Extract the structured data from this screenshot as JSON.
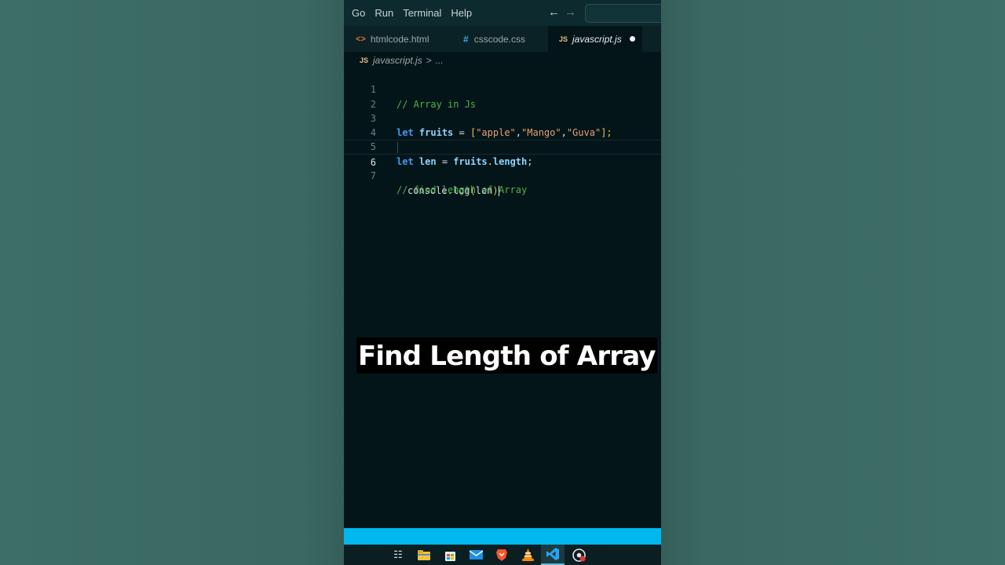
{
  "menubar": {
    "items": [
      "Go",
      "Run",
      "Terminal",
      "Help"
    ],
    "back_icon": "arrow-left-icon",
    "forward_icon": "arrow-right-icon"
  },
  "tabs": [
    {
      "label": "htmlcode.html",
      "icon": "html-file-icon",
      "icon_glyph": "<>",
      "active": false
    },
    {
      "label": "csscode.css",
      "icon": "css-file-icon",
      "icon_glyph": "#",
      "active": false
    },
    {
      "label": "javascript.js",
      "icon": "js-file-icon",
      "icon_glyph": "JS",
      "active": true,
      "unsaved": true
    }
  ],
  "breadcrumb": {
    "icon_glyph": "JS",
    "file": "javascript.js",
    "separator": ">",
    "rest": "..."
  },
  "editor": {
    "active_line": 6,
    "line_numbers": [
      "1",
      "2",
      "3",
      "4",
      "5",
      "6",
      "7"
    ],
    "lines": {
      "l1_comment": "// Array in Js",
      "l3_let": "let",
      "l3_var": "fruits",
      "l3_eq": " = ",
      "l3_open": "[",
      "l3_s1": "\"apple\"",
      "l3_c1": ",",
      "l3_s2": "\"Mango\"",
      "l3_c2": ",",
      "l3_s3": "\"Guva\"",
      "l3_close": "];",
      "l5_let": "let",
      "l5_var": "len",
      "l5_eq": " = ",
      "l5_obj": "fruits",
      "l5_dot": ".",
      "l5_prop": "length",
      "l5_semi": ";",
      "l6_obj": "console",
      "l6_dot": ".",
      "l6_fn": "log",
      "l6_open": "(",
      "l6_arg": "len",
      "l6_close": ")",
      "l7_comment": "// find length of Array"
    }
  },
  "caption": "Find Length of Array",
  "colors": {
    "accent_statusbar": "#00b7f0",
    "comment": "#4fb34a",
    "keyword": "#3e9cf0",
    "string": "#e6a070"
  },
  "taskbar": {
    "icons": [
      "task-view-icon",
      "file-explorer-icon",
      "store-icon",
      "mail-icon",
      "brave-browser-icon",
      "vlc-icon",
      "vscode-icon",
      "chrome-canary-icon"
    ]
  }
}
